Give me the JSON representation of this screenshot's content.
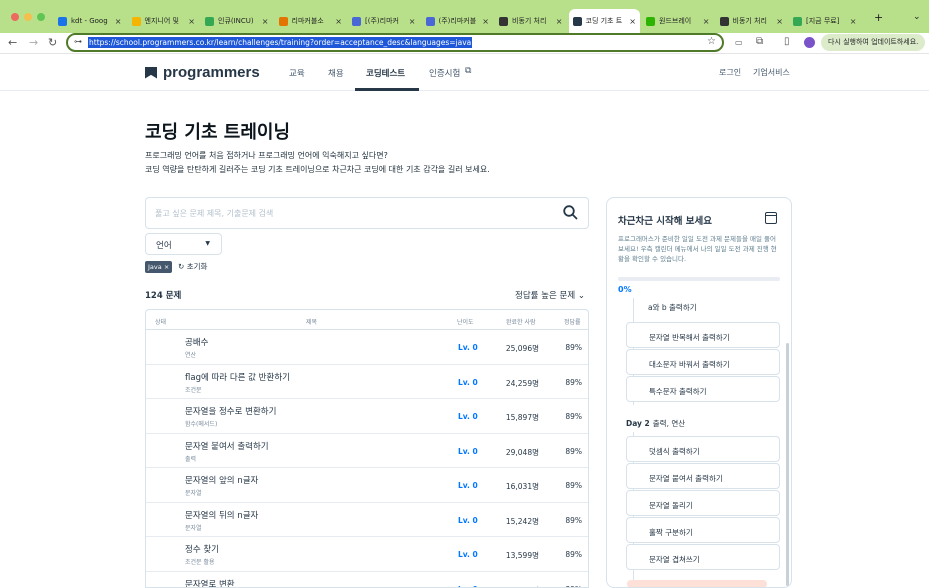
{
  "browser": {
    "tabs": [
      {
        "label": "kdt - Goog",
        "favicon": "drive-icon",
        "color": "#1a73e8"
      },
      {
        "label": "엔지니어 및",
        "favicon": "slides-icon",
        "color": "#f4b400"
      },
      {
        "label": "인큐(INCU)",
        "favicon": "incu-icon",
        "color": "#34a853"
      },
      {
        "label": "리마커블소",
        "favicon": "remarkable-icon",
        "color": "#e37400"
      },
      {
        "label": "[(주)리마커",
        "favicon": "s-icon",
        "color": "#4a67d6"
      },
      {
        "label": "(주)리마커블",
        "favicon": "s-icon",
        "color": "#4a67d6"
      },
      {
        "label": "비동기 처리",
        "favicon": "notion-icon",
        "color": "#333333"
      },
      {
        "label": "코딩 기초 트",
        "favicon": "programmers-icon",
        "color": "#263747",
        "active": true
      },
      {
        "label": "원드브레이",
        "favicon": "leaf-icon",
        "color": "#2db400"
      },
      {
        "label": "비동기 처리",
        "favicon": "notion-icon",
        "color": "#333333"
      },
      {
        "label": "[지금 무료]",
        "favicon": "inflearn-icon",
        "color": "#34a853"
      }
    ],
    "new_tab": "+",
    "url": "https://school.programmers.co.kr/learn/challenges/training?order=acceptance_desc&languages=java",
    "update_label": "다시 실행하여 업데이트하세요."
  },
  "header": {
    "logo": "programmers",
    "nav": [
      "교육",
      "채용",
      "코딩테스트",
      "인증시험"
    ],
    "active_nav": "코딩테스트",
    "login": "로그인",
    "business": "기업서비스"
  },
  "page": {
    "title": "코딩 기초 트레이닝",
    "desc1": "프로그래밍 언어를 처음 접하거나 프로그래밍 언어에 익숙해지고 싶다면?",
    "desc2": "코딩 역량을 탄탄하게 길러주는 코딩 기초 트레이닝으로 차근차근 코딩에 대한 기초 감각을 길러 보세요.",
    "search_placeholder": "풀고 싶은 문제 제목, 기출문제 검색",
    "language_label": "언어",
    "chip": "Java",
    "chip_close": "×",
    "reset": "초기화",
    "count": "124 문제",
    "sort": "정답률 높은 문제"
  },
  "table": {
    "headers": {
      "status": "상태",
      "title": "제목",
      "level": "난이도",
      "completed": "완료한 사람",
      "rate": "정답률"
    },
    "rows": [
      {
        "title": "공배수",
        "category": "연산",
        "level": "Lv. 0",
        "completed": "25,096명",
        "rate": "89%"
      },
      {
        "title": "flag에 따라 다른 값 반환하기",
        "category": "조건문",
        "level": "Lv. 0",
        "completed": "24,259명",
        "rate": "89%"
      },
      {
        "title": "문자열을 정수로 변환하기",
        "category": "함수(메서드)",
        "level": "Lv. 0",
        "completed": "15,897명",
        "rate": "89%"
      },
      {
        "title": "문자열 붙여서 출력하기",
        "category": "출력",
        "level": "Lv. 0",
        "completed": "29,048명",
        "rate": "89%"
      },
      {
        "title": "문자열의 앞의 n글자",
        "category": "문자열",
        "level": "Lv. 0",
        "completed": "16,031명",
        "rate": "89%"
      },
      {
        "title": "문자열의 뒤의 n글자",
        "category": "문자열",
        "level": "Lv. 0",
        "completed": "15,242명",
        "rate": "89%"
      },
      {
        "title": "정수 찾기",
        "category": "조건문 활용",
        "level": "Lv. 0",
        "completed": "13,599명",
        "rate": "89%"
      },
      {
        "title": "문자열로 변환",
        "category": "",
        "level": "Lv. 0",
        "completed": "15,517명",
        "rate": "89%"
      }
    ]
  },
  "side": {
    "title": "차근차근 시작해 보세요",
    "desc": "프로그래머스가 준비한 일일 도전 과제 문제들을 매일 풀어 보세요! 우측 캘린더 메뉴에서 나의 일일 도전 과제 진행 현황을 확인할 수 있습니다.",
    "progress_value": 0,
    "progress_text": "0%",
    "day1_items": [
      "a와 b 출력하기",
      "문자열 반복해서 출력하기",
      "대소문자 바꿔서 출력하기",
      "특수문자 출력하기"
    ],
    "day2_label": "Day 2",
    "day2_title": "출력, 연산",
    "day2_items": [
      "덧셈식 출력하기",
      "문자열 붙여서 출력하기",
      "문자열 돌리기",
      "홀짝 구분하기",
      "문자열 겹쳐쓰기"
    ]
  }
}
